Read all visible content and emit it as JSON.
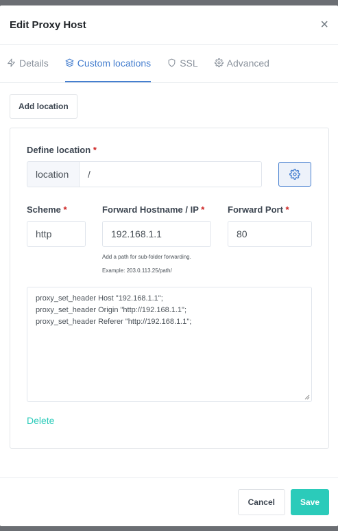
{
  "modal": {
    "title": "Edit Proxy Host",
    "close_glyph": "×"
  },
  "tabs": [
    {
      "label": "Details",
      "icon": "lightning-icon",
      "active": false
    },
    {
      "label": "Custom locations",
      "icon": "layers-icon",
      "active": true
    },
    {
      "label": "SSL",
      "icon": "shield-icon",
      "active": false
    },
    {
      "label": "Advanced",
      "icon": "gear-icon",
      "active": false
    }
  ],
  "add_location_label": "Add location",
  "location": {
    "define_label": "Define location",
    "required_mark": "*",
    "prefix": "location",
    "value": "/"
  },
  "scheme": {
    "label": "Scheme",
    "value": "http"
  },
  "forward_host": {
    "label": "Forward Hostname / IP",
    "value": "192.168.1.1",
    "help_1": "Add a path for sub-folder forwarding.",
    "help_2": "Example: 203.0.113.25/path/"
  },
  "forward_port": {
    "label": "Forward Port",
    "value": "80"
  },
  "advanced_config": {
    "lines": [
      "proxy_set_header Host \"192.168.1.1\";",
      "proxy_set_header Origin \"http://192.168.1.1\";",
      "proxy_set_header Referer \"http://192.168.1.1\";"
    ]
  },
  "delete_label": "Delete",
  "footer": {
    "cancel_label": "Cancel",
    "save_label": "Save"
  },
  "colors": {
    "accent": "#467fcf",
    "teal": "#2bcbba",
    "required": "#cd201f"
  }
}
